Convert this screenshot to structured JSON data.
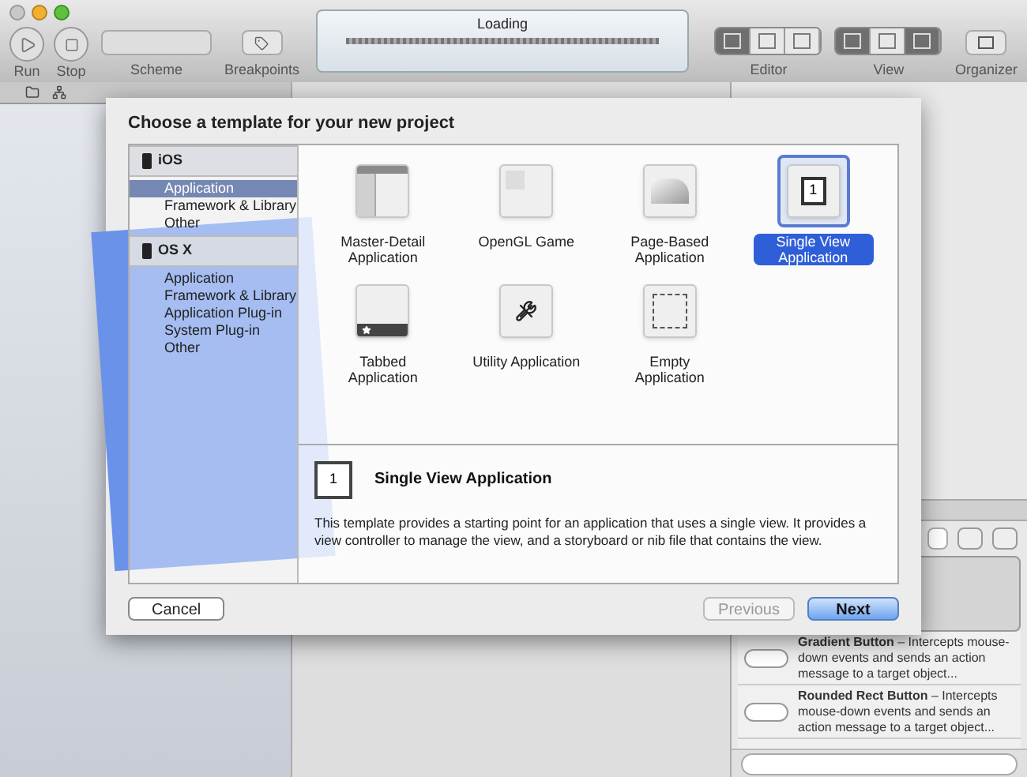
{
  "toolbar": {
    "run": {
      "label": "Run"
    },
    "stop": {
      "label": "Stop"
    },
    "scheme": {
      "label": "Scheme"
    },
    "breakpoints": {
      "label": "Breakpoints"
    },
    "activity": {
      "title": "Loading",
      "level": 1
    },
    "editor": {
      "label": "Editor",
      "buttons": [
        {
          "selected": true
        },
        {
          "selected": false
        },
        {
          "selected": false
        }
      ]
    },
    "view": {
      "label": "View",
      "buttons": [
        {
          "selected": true
        },
        {
          "selected": false
        },
        {
          "selected": true
        }
      ]
    },
    "organizer": {
      "label": "Organizer"
    }
  },
  "sheet": {
    "title": "Choose a template for your new project",
    "categories": [
      {
        "platform": "iOS",
        "items": [
          {
            "label": "Application",
            "selected": true
          },
          {
            "label": "Framework & Library",
            "selected": false
          },
          {
            "label": "Other",
            "selected": false
          }
        ]
      },
      {
        "platform": "OS X",
        "items": [
          {
            "label": "Application",
            "selected": false
          },
          {
            "label": "Framework & Library",
            "selected": false
          },
          {
            "label": "Application Plug-in",
            "selected": false
          },
          {
            "label": "System Plug-in",
            "selected": false
          },
          {
            "label": "Other",
            "selected": false
          }
        ]
      }
    ],
    "templates": [
      {
        "kind": "master_detail",
        "label": "Master-Detail Application",
        "selected": false
      },
      {
        "kind": "opengl",
        "label": "OpenGL Game",
        "selected": false
      },
      {
        "kind": "page",
        "label": "Page-Based Application",
        "selected": false
      },
      {
        "kind": "single",
        "label": "Single View Application",
        "icon_text": "1",
        "selected": true
      },
      {
        "kind": "tabbed",
        "label": "Tabbed Application",
        "selected": false
      },
      {
        "kind": "utility",
        "label": "Utility Application",
        "selected": false
      },
      {
        "kind": "empty",
        "label": "Empty Application",
        "selected": false
      }
    ],
    "detail": {
      "icon_text": "1",
      "title": "Single View Application",
      "description": "This template provides a starting point for an application that uses a single view. It provides a view controller to manage the view, and a storyboard or nib file that contains the view."
    },
    "buttons": {
      "cancel": {
        "label": "Cancel"
      },
      "previous": {
        "label": "Previous",
        "disabled": true
      },
      "next": {
        "label": "Next",
        "disabled": false
      }
    }
  },
  "library": {
    "items": [
      {
        "text": "**Gradient Button** – Intercepts mouse-down events and sends an action message to a target object..."
      },
      {
        "text": "**Rounded Rect Button** – Intercepts mouse-down events and sends an action message to a target object..."
      }
    ]
  }
}
